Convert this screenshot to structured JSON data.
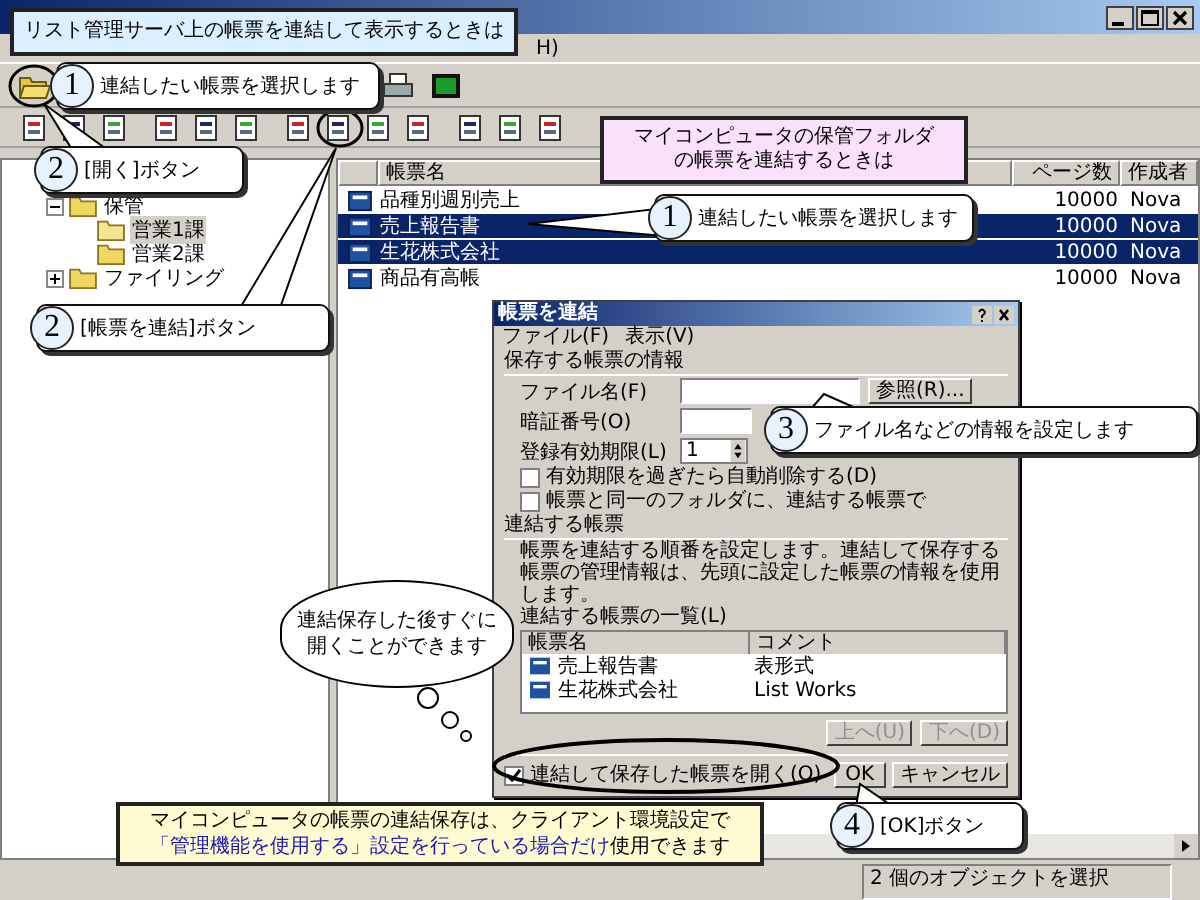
{
  "header_callout": "リスト管理サーバ上の帳票を連結して表示するときは",
  "menu_fragment": "H)",
  "tree": [
    {
      "label": "保管",
      "expanded": true,
      "children": [
        {
          "label": "営業1課",
          "selected": true
        },
        {
          "label": "営業2課",
          "selected": false
        }
      ]
    },
    {
      "label": "ファイリング",
      "expanded": false
    }
  ],
  "list": {
    "columns": [
      "帳票名",
      "ページ数",
      "作成者"
    ],
    "rows": [
      {
        "name": "品種別週別売上",
        "pages": "10000",
        "author": "Nova",
        "selected": false
      },
      {
        "name": "売上報告書",
        "pages": "10000",
        "author": "Nova",
        "selected": true
      },
      {
        "name": "生花株式会社",
        "pages": "10000",
        "author": "Nova",
        "selected": true
      },
      {
        "name": "商品有高帳",
        "pages": "10000",
        "author": "Nova",
        "selected": false
      }
    ]
  },
  "folder_callout": [
    "マイコンピュータの保管フォルダ",
    "の帳票を連結するときは"
  ],
  "callouts": [
    {
      "number": "1",
      "text": "連結したい帳票を選択します"
    },
    {
      "number": "2",
      "text": "[開く]ボタン"
    },
    {
      "number": "1",
      "text": "連結したい帳票を選択します"
    },
    {
      "number": "2",
      "text": "[帳票を連結]ボタン"
    },
    {
      "number": "3",
      "text": "ファイル名などの情報を設定します"
    },
    {
      "number": "4",
      "text": "[OK]ボタン"
    }
  ],
  "dialog": {
    "title": "帳票を連結",
    "menu": [
      "ファイル(F)",
      "表示(V)"
    ],
    "section_1": "保存する帳票の情報",
    "file_label": "ファイル名(F)",
    "browse_button": "参照(R)...",
    "pin_label": "暗証番号(O)",
    "expiry_label": "登録有効期限(L)",
    "expiry_value": "1",
    "checkboxes": [
      {
        "label": "有効期限を過ぎたら自動削除する(D)",
        "checked": false
      },
      {
        "label": "帳票と同一のフォルダに、連結する帳票で",
        "checked": false
      }
    ],
    "section_2": "連結する帳票",
    "description": "帳票を連結する順番を設定します。連結して保存する帳票の管理情報は、先頭に設定した帳票の情報を使用します。",
    "list_label": "連結する帳票の一覧(L)",
    "list_columns": [
      "帳票名",
      "コメント"
    ],
    "list_rows": [
      {
        "name": "売上報告書",
        "comment": "表形式"
      },
      {
        "name": "生花株式会社",
        "comment": "List Works"
      }
    ],
    "up_button": "上へ(U)",
    "down_button": "下へ(D)",
    "open_checkbox": {
      "label": "連結して保存した帳票を開く(O)",
      "checked": true
    },
    "ok_button": "OK",
    "cancel_button": "キャンセル"
  },
  "cloud": [
    "連結保存した後すぐに",
    "開くことができます"
  ],
  "note": {
    "line_1": "マイコンピュータの帳票の連結保存は、クライアント環境設定で",
    "highlight": "「管理機能を使用する」設定を行っている場合だけ",
    "rest": "使用できます"
  },
  "status_bar": "2 個のオブジェクトを選択"
}
